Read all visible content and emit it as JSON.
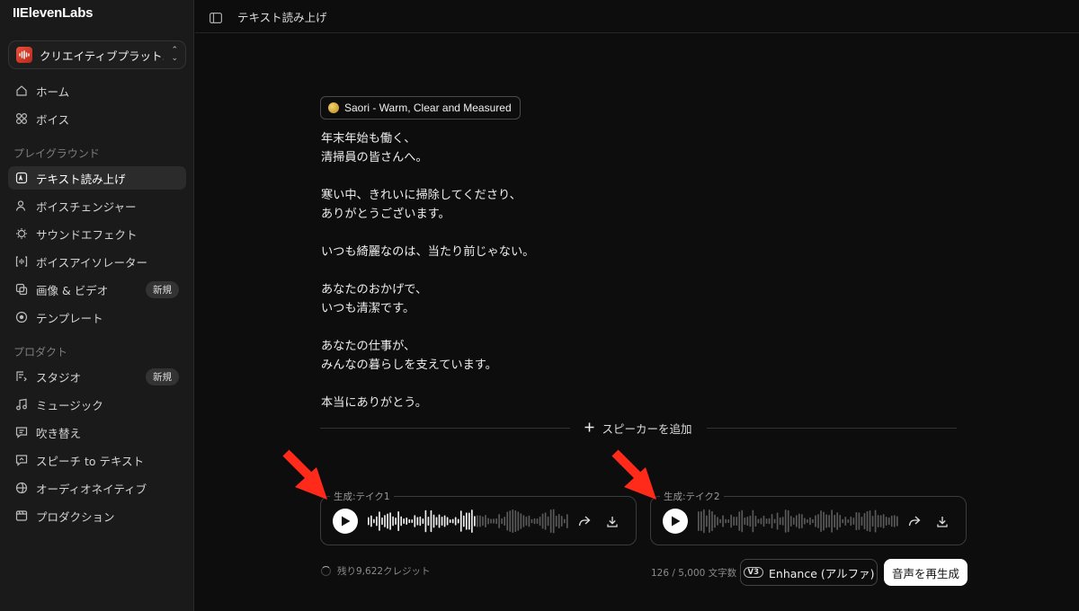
{
  "app": {
    "logo_text": "IIElevenLabs",
    "workspace_name": "クリエイティブプラット...",
    "accent": "#ff2a1a"
  },
  "sidebar": {
    "top_items": [
      {
        "label": "ホーム",
        "icon": "home-icon"
      },
      {
        "label": "ボイス",
        "icon": "voices-grid-icon"
      }
    ],
    "sections": [
      {
        "label": "プレイグラウンド",
        "items": [
          {
            "label": "テキスト読み上げ",
            "icon": "text-to-speech-icon",
            "active": true
          },
          {
            "label": "ボイスチェンジャー",
            "icon": "voice-changer-icon"
          },
          {
            "label": "サウンドエフェクト",
            "icon": "sound-effects-icon"
          },
          {
            "label": "ボイスアイソレーター",
            "icon": "voice-isolator-icon"
          },
          {
            "label": "画像 & ビデオ",
            "icon": "image-video-icon",
            "badge": "新規"
          },
          {
            "label": "テンプレート",
            "icon": "templates-icon"
          }
        ]
      },
      {
        "label": "プロダクト",
        "items": [
          {
            "label": "スタジオ",
            "icon": "studio-icon",
            "badge": "新規"
          },
          {
            "label": "ミュージック",
            "icon": "music-icon"
          },
          {
            "label": "吹き替え",
            "icon": "dubbing-icon"
          },
          {
            "label": "スピーチ to テキスト",
            "icon": "speech-to-text-icon"
          },
          {
            "label": "オーディオネイティブ",
            "icon": "audio-native-icon"
          },
          {
            "label": "プロダクション",
            "icon": "productions-icon"
          }
        ]
      }
    ]
  },
  "header": {
    "title": "テキスト読み上げ"
  },
  "editor": {
    "voice_label": "Saori - Warm, Clear and Measured",
    "text": "年末年始も働く、\n清掃員の皆さんへ。\n\n寒い中、きれいに掃除してくださり、\nありがとうございます。\n\nいつも綺麗なのは、当たり前じゃない。\n\nあなたのおかげで、\nいつも清潔です。\n\nあなたの仕事が、\nみんなの暮らしを支えています。\n\n本当にありがとう。",
    "add_speaker_label": "スピーカーを追加"
  },
  "takes": [
    {
      "label": "生成:テイク1",
      "played_fraction": 0.53
    },
    {
      "label": "生成:テイク2",
      "played_fraction": 0.0
    }
  ],
  "footer": {
    "credits_text": "残り9,622クレジット",
    "char_count": "126 / 5,000 文字数",
    "enhance_badge": "V3",
    "enhance_label": "Enhance (アルファ)",
    "regenerate_label": "音声を再生成"
  }
}
